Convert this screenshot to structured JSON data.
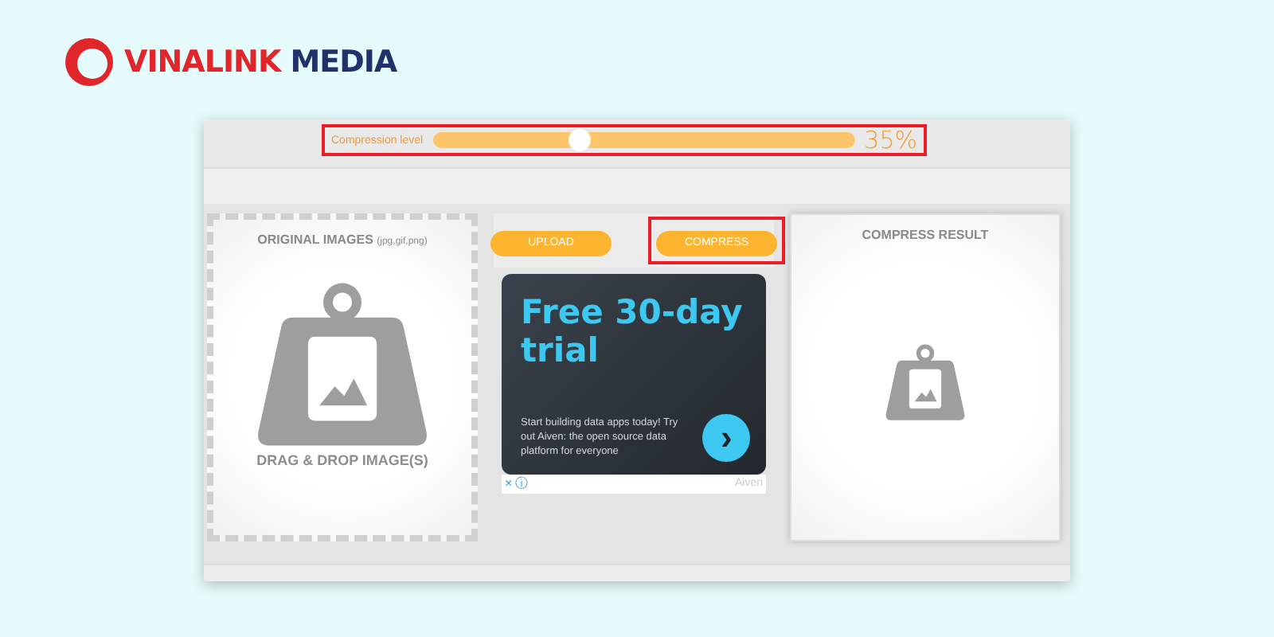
{
  "brand": {
    "name": "VINALINK",
    "suffix": "MEDIA"
  },
  "compression": {
    "label": "Compression level",
    "level": 0.35,
    "reading": "35%",
    "highlighted": true
  },
  "source_panel": {
    "title": "ORIGINAL IMAGES",
    "formats": "(jpg,gif,png)",
    "hint": "DRAG & DROP IMAGE(S)"
  },
  "buttons": [
    {
      "label": "UPLOAD",
      "highlighted": false
    },
    {
      "label": "COMPRESS",
      "highlighted": true
    }
  ],
  "ad": {
    "title": "Free 30-day trial",
    "body": "Start building data apps today! Try out Aiven: the open source data platform for everyone",
    "arrow": "›",
    "close": "×",
    "info": "ⓘ",
    "advertiser": "Aiven"
  },
  "result_panel": {
    "title": "COMPRESS RESULT"
  }
}
